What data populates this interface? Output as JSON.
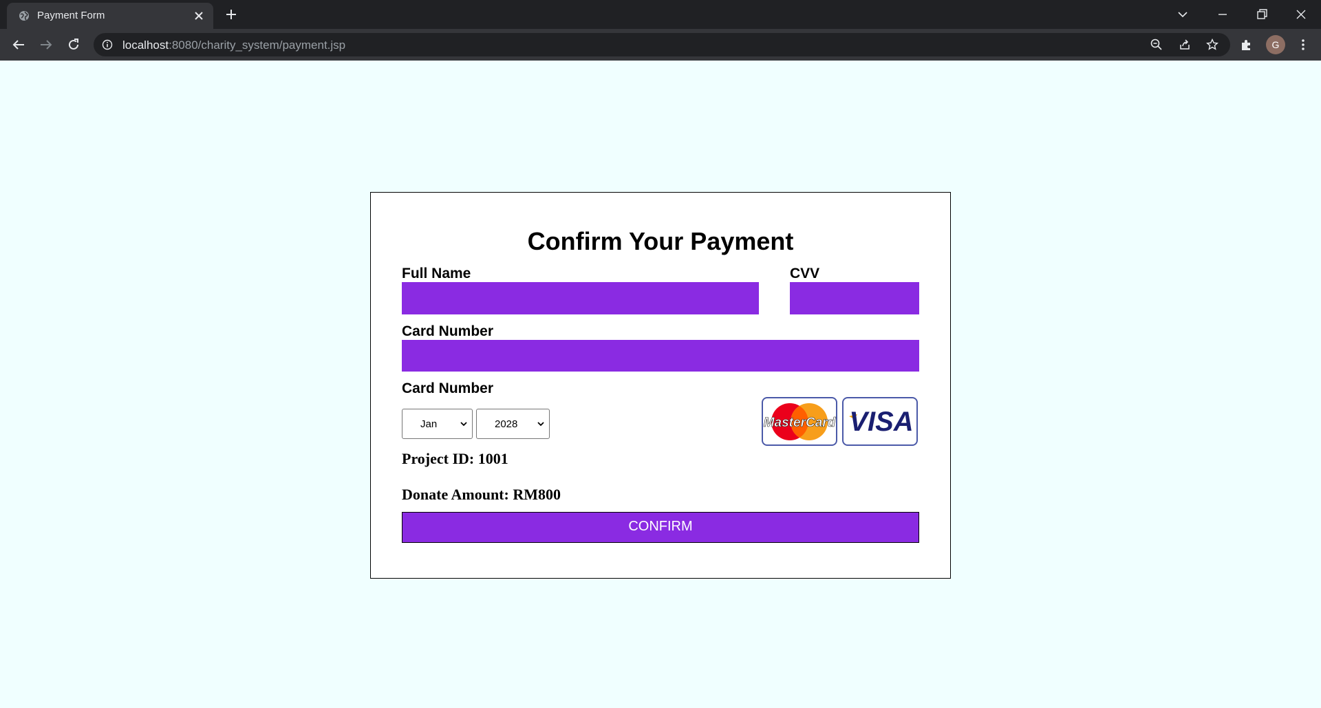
{
  "browser": {
    "tab_title": "Payment Form",
    "url_host": "localhost",
    "url_rest": ":8080/charity_system/payment.jsp",
    "profile_initial": "G"
  },
  "form": {
    "title": "Confirm Your Payment",
    "full_name_label": "Full Name",
    "cvv_label": "CVV",
    "card_number_label": "Card Number",
    "expiry_label": "Card Number",
    "expiry_month": "Jan",
    "expiry_year": "2028",
    "project_id_text": "Project ID: 1001",
    "donate_amount_text": "Donate Amount: RM800",
    "confirm_label": "CONFIRM",
    "card_brands": [
      "MasterCard",
      "VISA"
    ]
  },
  "colors": {
    "page_background": "#f0ffff",
    "field_fill": "#8a2be2",
    "button_fill": "#8a2be2"
  }
}
